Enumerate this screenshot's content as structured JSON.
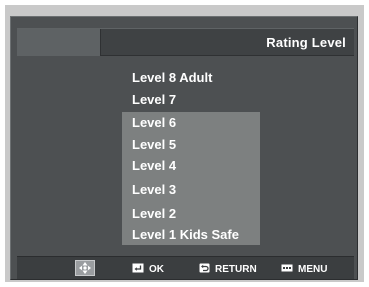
{
  "header": {
    "title": "Rating Level"
  },
  "levels": [
    "Level  8  Adult",
    "Level  7",
    "Level  6",
    "Level  5",
    "Level  4",
    "Level  3",
    "Level  2",
    "Level  1 Kids Safe"
  ],
  "footer": {
    "navigate_icon": "four-way-arrow-icon",
    "ok_icon": "enter-icon",
    "ok_label": "OK",
    "return_icon": "return-arrow-icon",
    "return_label": "RETURN",
    "menu_icon": "menu-icon",
    "menu_label": "MENU"
  },
  "colors": {
    "background": "#4d5052",
    "highlight_panel": "#7d8080",
    "text": "#ffffff"
  }
}
